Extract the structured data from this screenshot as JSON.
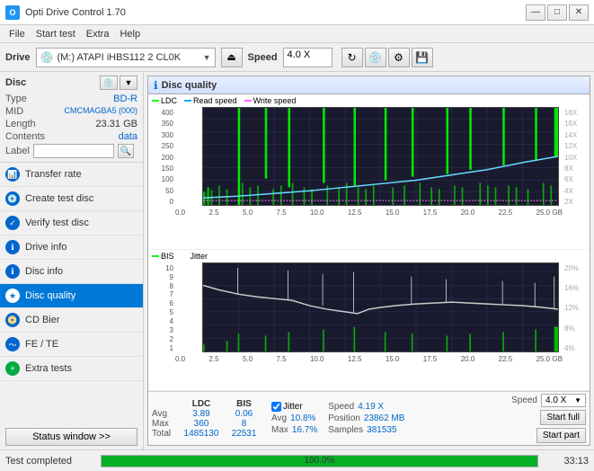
{
  "app": {
    "title": "Opti Drive Control 1.70",
    "icon_text": "O"
  },
  "titlebar": {
    "minimize_label": "—",
    "maximize_label": "□",
    "close_label": "✕"
  },
  "menubar": {
    "items": [
      "File",
      "Start test",
      "Extra",
      "Help"
    ]
  },
  "drivebar": {
    "drive_label": "Drive",
    "drive_value": "(M:)  ATAPI iHBS112  2 CL0K",
    "speed_label": "Speed",
    "speed_value": "4.0 X"
  },
  "disc": {
    "title": "Disc",
    "type_label": "Type",
    "type_value": "BD-R",
    "mid_label": "MID",
    "mid_value": "CMCMAGBA5 (000)",
    "length_label": "Length",
    "length_value": "23.31 GB",
    "contents_label": "Contents",
    "contents_value": "data",
    "label_label": "Label",
    "label_placeholder": ""
  },
  "nav": {
    "items": [
      {
        "id": "transfer-rate",
        "label": "Transfer rate",
        "active": false
      },
      {
        "id": "create-test-disc",
        "label": "Create test disc",
        "active": false
      },
      {
        "id": "verify-test-disc",
        "label": "Verify test disc",
        "active": false
      },
      {
        "id": "drive-info",
        "label": "Drive info",
        "active": false
      },
      {
        "id": "disc-info",
        "label": "Disc info",
        "active": false
      },
      {
        "id": "disc-quality",
        "label": "Disc quality",
        "active": true
      },
      {
        "id": "cd-bier",
        "label": "CD Bier",
        "active": false
      },
      {
        "id": "fe-te",
        "label": "FE / TE",
        "active": false
      },
      {
        "id": "extra-tests",
        "label": "Extra tests",
        "active": false
      }
    ],
    "status_window_label": "Status window >>"
  },
  "quality_panel": {
    "title": "Disc quality",
    "legend_ldc": "LDC",
    "legend_read": "Read speed",
    "legend_write": "Write speed",
    "legend_bis": "BIS",
    "legend_jitter": "Jitter",
    "top_chart": {
      "y_labels_left": [
        "400",
        "350",
        "300",
        "250",
        "200",
        "150",
        "100",
        "50",
        "0"
      ],
      "y_labels_right": [
        "18X",
        "16X",
        "14X",
        "12X",
        "10X",
        "8X",
        "6X",
        "4X",
        "2X"
      ],
      "x_labels": [
        "0.0",
        "2.5",
        "5.0",
        "7.5",
        "10.0",
        "12.5",
        "15.0",
        "17.5",
        "20.0",
        "22.5",
        "25.0 GB"
      ]
    },
    "bottom_chart": {
      "y_labels_left": [
        "10",
        "9",
        "8",
        "7",
        "6",
        "5",
        "4",
        "3",
        "2",
        "1"
      ],
      "y_labels_right": [
        "20%",
        "16%",
        "12%",
        "8%",
        "4%"
      ],
      "x_labels": [
        "0.0",
        "2.5",
        "5.0",
        "7.5",
        "10.0",
        "12.5",
        "15.0",
        "17.5",
        "20.0",
        "22.5",
        "25.0 GB"
      ]
    }
  },
  "stats": {
    "ldc_label": "LDC",
    "bis_label": "BIS",
    "jitter_label": "Jitter",
    "speed_label": "Speed",
    "avg_label": "Avg",
    "max_label": "Max",
    "total_label": "Total",
    "ldc_avg": "3.89",
    "ldc_max": "360",
    "ldc_total": "1485130",
    "bis_avg": "0.06",
    "bis_max": "8",
    "bis_total": "22531",
    "jitter_avg": "10.8%",
    "jitter_max": "16.7%",
    "jitter_check": true,
    "speed_avg": "4.19 X",
    "speed_value": "4.0 X",
    "position_label": "Position",
    "position_value": "23862 MB",
    "samples_label": "Samples",
    "samples_value": "381535",
    "start_full_label": "Start full",
    "start_part_label": "Start part"
  },
  "statusbar": {
    "status_text": "Test completed",
    "progress_pct": 100,
    "progress_label": "100.0%",
    "time_value": "33:13"
  }
}
